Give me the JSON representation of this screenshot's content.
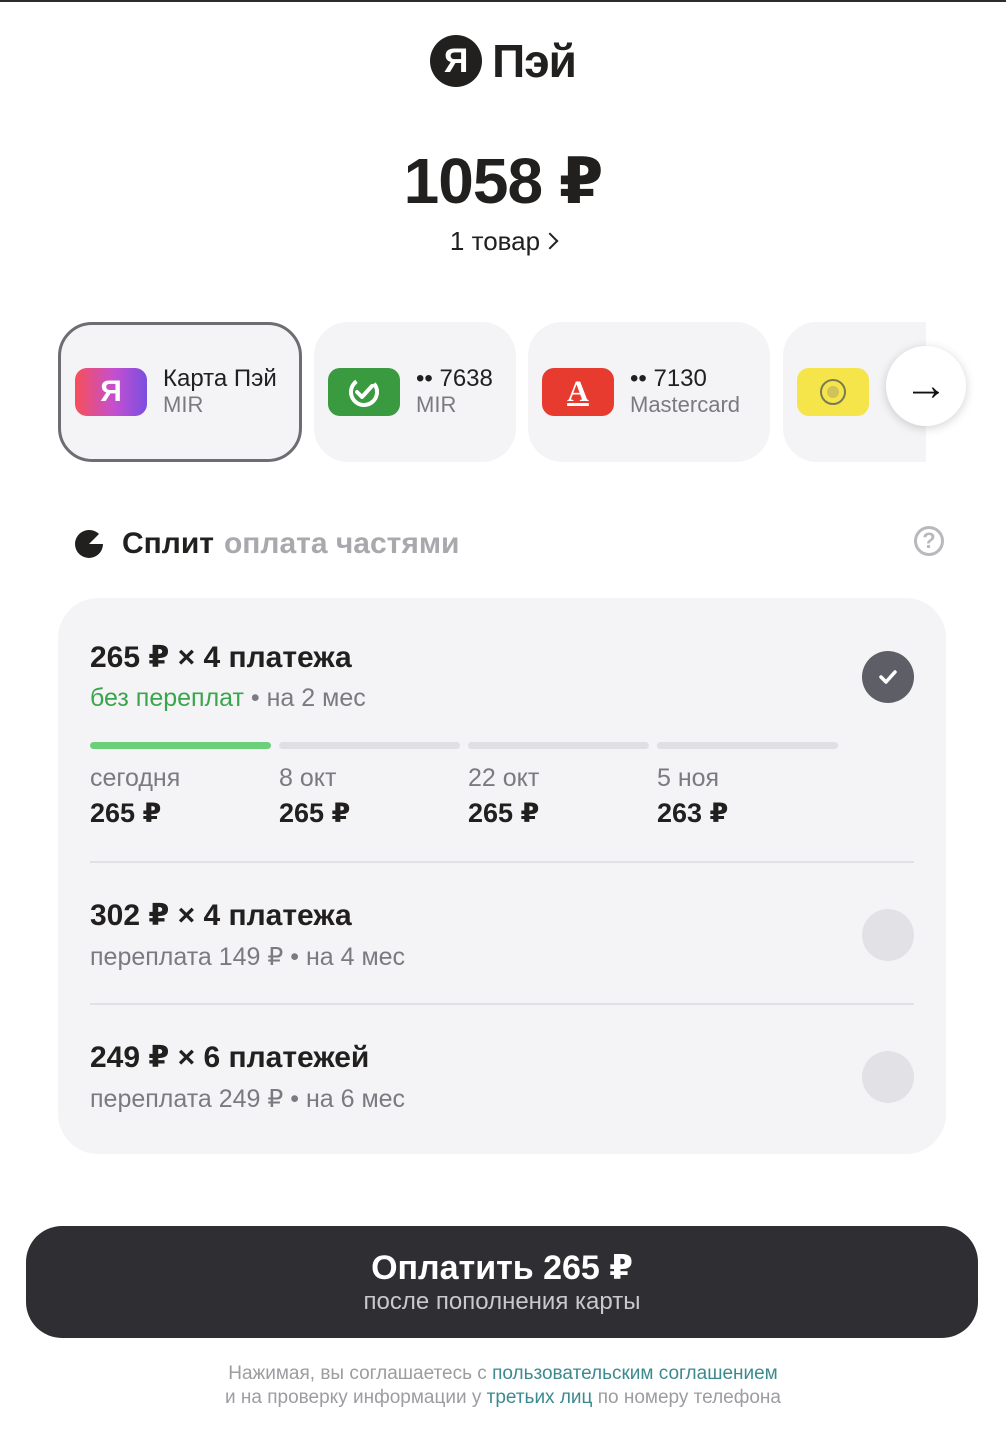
{
  "brand": {
    "mark": "Я",
    "name": "Пэй"
  },
  "order": {
    "amount": "1058 ₽",
    "items": "1 товар"
  },
  "cards": [
    {
      "title": "Карта Пэй",
      "sub": "MIR",
      "logo_text": "Я",
      "color": "#7b4fe0",
      "selected": true
    },
    {
      "title": "•• 7638",
      "sub": "MIR",
      "logo_text": "",
      "color": "#3a9a3f",
      "selected": false
    },
    {
      "title": "•• 7130",
      "sub": "Mastercard",
      "logo_text": "А",
      "color": "#e63b2e",
      "selected": false
    },
    {
      "title": "",
      "sub": "",
      "logo_text": "",
      "color": "#f5e54a",
      "selected": false
    }
  ],
  "split": {
    "title": "Сплит",
    "subtitle": "оплата частями"
  },
  "plans": [
    {
      "title": "265 ₽ × 4 платежа",
      "sub_green": "без переплат",
      "sub_rest": " • на 2 мес",
      "selected": true,
      "schedule": [
        {
          "date": "сегодня",
          "amount": "265 ₽"
        },
        {
          "date": "8 окт",
          "amount": "265 ₽"
        },
        {
          "date": "22 окт",
          "amount": "265 ₽"
        },
        {
          "date": "5 ноя",
          "amount": "263 ₽"
        }
      ]
    },
    {
      "title": "302 ₽ × 4 платежа",
      "sub": "переплата 149 ₽ • на 4 мес",
      "selected": false
    },
    {
      "title": "249 ₽ × 6 платежей",
      "sub": "переплата 249 ₽ • на 6 мес",
      "selected": false
    }
  ],
  "pay_button": {
    "label": "Оплатить 265 ₽",
    "sub": "после пополнения карты"
  },
  "legal": {
    "line1_text": "Нажимая, вы соглашаетесь с ",
    "line1_link": "пользовательским соглашением",
    "line2_text_a": "и на проверку информации у ",
    "line2_link": "третьих лиц",
    "line2_text_b": " по номеру телефона"
  },
  "colors": {
    "accent_green": "#3aa64b",
    "button_dark": "#2f2f33",
    "link": "#3b8a8f"
  }
}
